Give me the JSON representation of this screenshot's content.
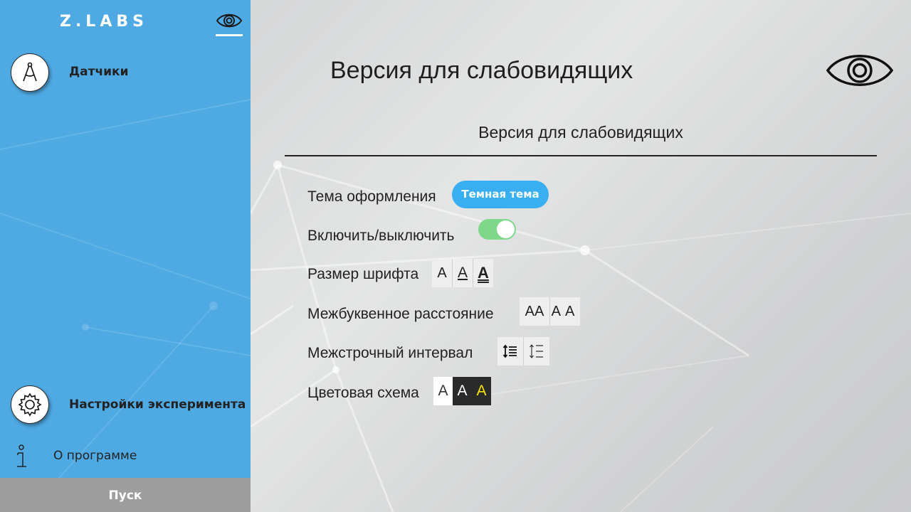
{
  "sidebar": {
    "logo": "Z.LABS",
    "nav": {
      "sensors_label": "Датчики",
      "settings_label": "Настройки эксперимента",
      "about_label": "О программе"
    },
    "start_label": "Пуск",
    "icons": {
      "eye_toggle": "eye-icon",
      "sensors": "compass-icon",
      "settings": "gear-icon",
      "about": "info-icon"
    }
  },
  "main": {
    "page_title": "Версия для слабовидящих",
    "section_title": "Версия для слабовидящих",
    "rows": {
      "theme_label": "Тема оформления",
      "theme_button": "Темная тема",
      "toggle_label": "Включить/выключить",
      "toggle_on": true,
      "fontsize_label": "Размер шрифта",
      "fontsize_options": [
        "A",
        "A",
        "A"
      ],
      "letter_label": "Межбуквенное расстояние",
      "letter_options": [
        "AA",
        "AA"
      ],
      "line_label": "Межстрочный интервал",
      "color_label": "Цветовая схема",
      "color_options": [
        "A",
        "A",
        "A"
      ]
    }
  },
  "colors": {
    "sidebar_bg": "#4fa9e3",
    "accent_button": "#39aef0",
    "toggle_on": "#7fd88a",
    "start_bar": "#9e9e9e",
    "scheme_yellow": "#f7e400"
  }
}
